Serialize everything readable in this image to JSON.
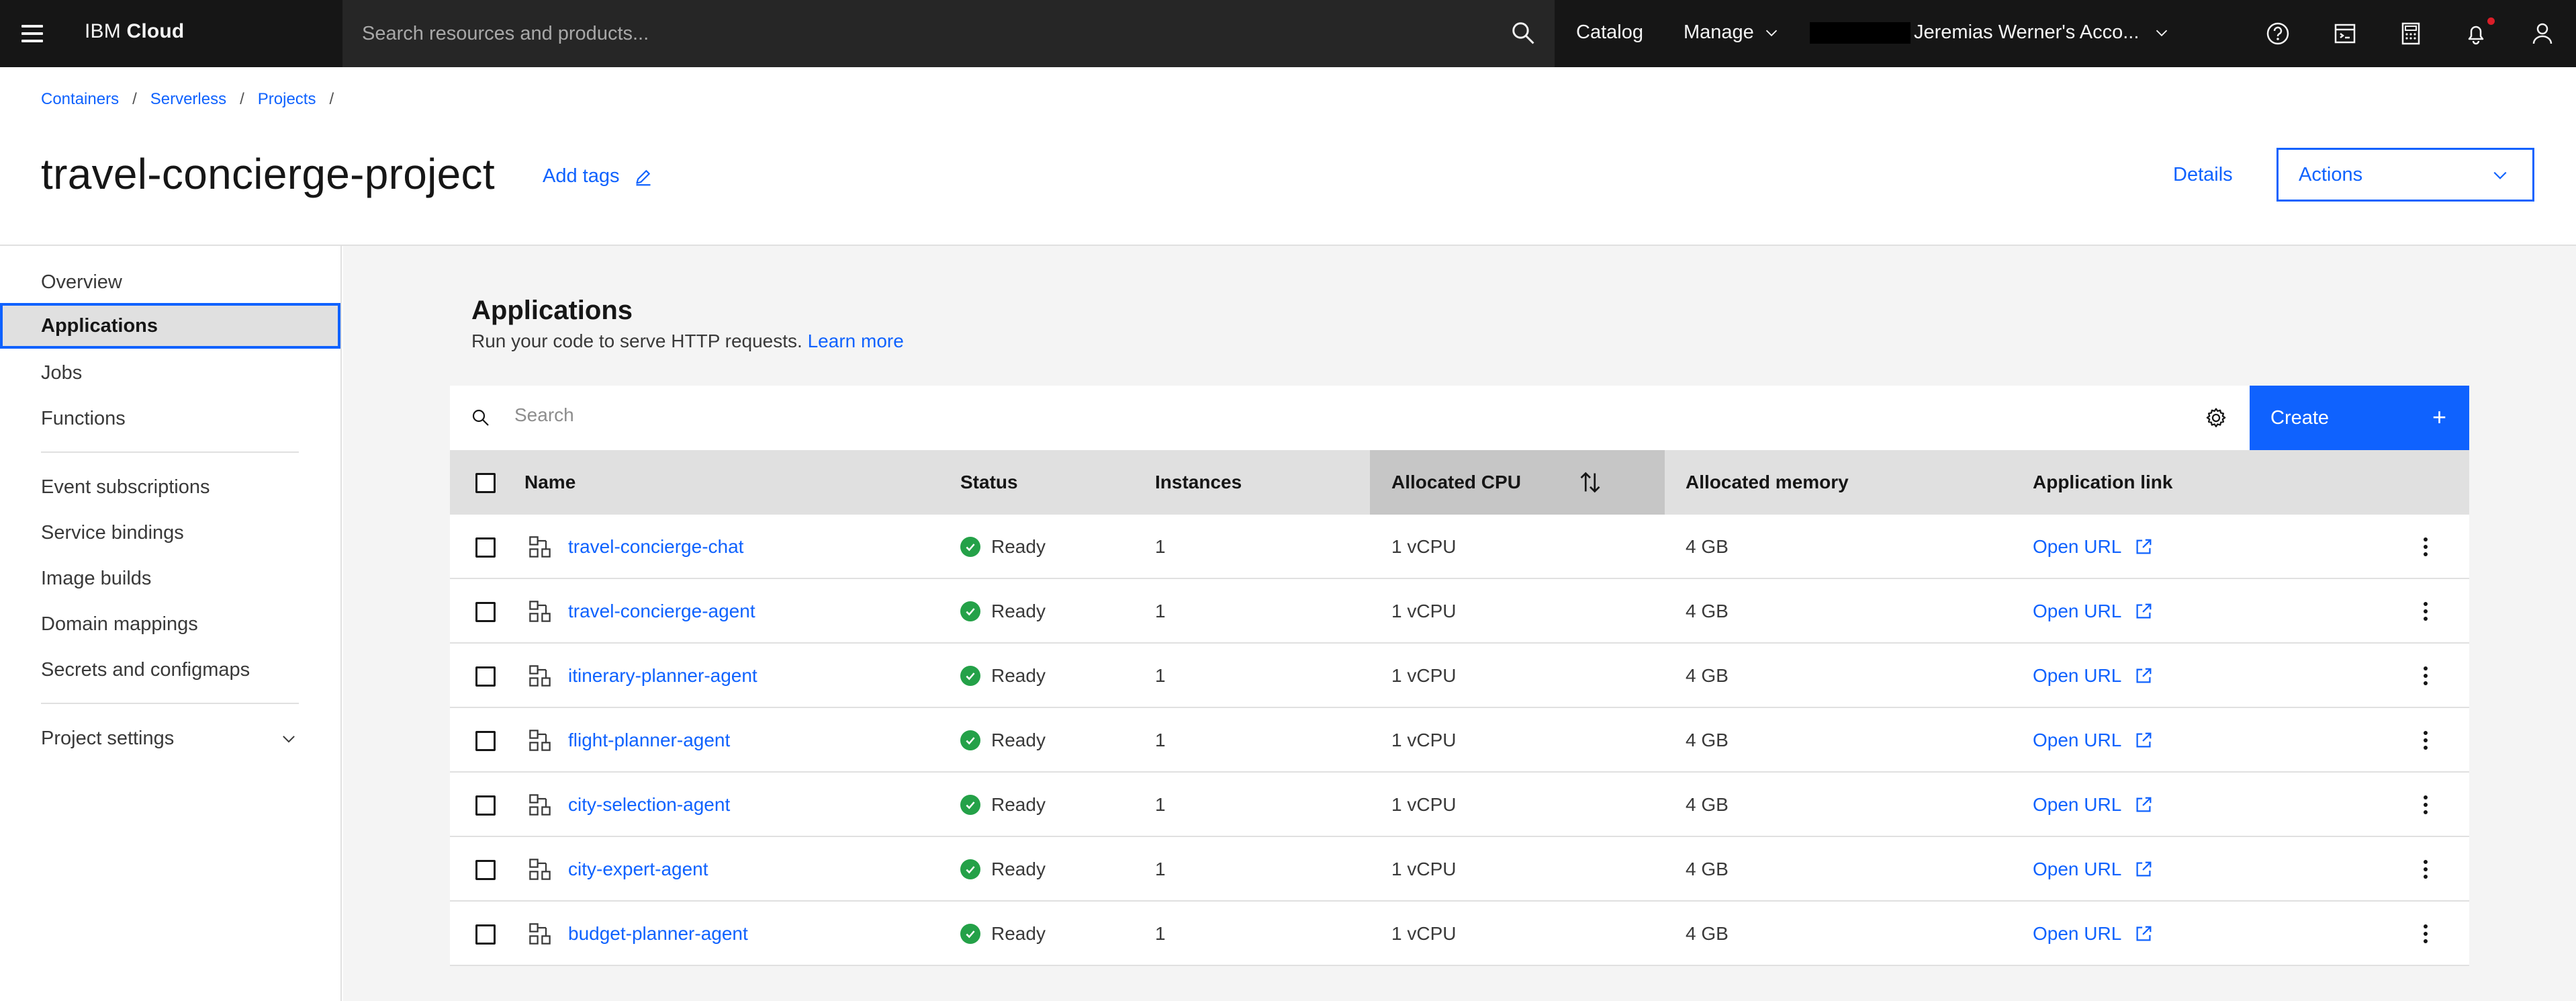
{
  "header": {
    "brand_light": "IBM",
    "brand_bold": "Cloud",
    "search_placeholder": "Search resources and products...",
    "catalog": "Catalog",
    "manage": "Manage",
    "account": "Jeremias Werner's Acco..."
  },
  "breadcrumb": [
    "Containers",
    "Serverless",
    "Projects"
  ],
  "page": {
    "title": "travel-concierge-project",
    "add_tags": "Add tags",
    "details": "Details",
    "actions": "Actions"
  },
  "sidenav": {
    "items": [
      "Overview",
      "Applications",
      "Jobs",
      "Functions"
    ],
    "items2": [
      "Event subscriptions",
      "Service bindings",
      "Image builds",
      "Domain mappings",
      "Secrets and configmaps"
    ],
    "settings": "Project settings",
    "active": "Applications"
  },
  "section": {
    "title": "Applications",
    "subtitle": "Run your code to serve HTTP requests.",
    "learn_more": "Learn more"
  },
  "toolbar": {
    "search_placeholder": "Search",
    "create": "Create"
  },
  "table": {
    "columns": [
      "Name",
      "Status",
      "Instances",
      "Allocated CPU",
      "Allocated memory",
      "Application link"
    ],
    "sorted_column": "Allocated CPU",
    "rows": [
      {
        "name": "travel-concierge-chat",
        "status": "Ready",
        "instances": "1",
        "cpu": "1 vCPU",
        "memory": "4 GB",
        "link": "Open URL"
      },
      {
        "name": "travel-concierge-agent",
        "status": "Ready",
        "instances": "1",
        "cpu": "1 vCPU",
        "memory": "4 GB",
        "link": "Open URL"
      },
      {
        "name": "itinerary-planner-agent",
        "status": "Ready",
        "instances": "1",
        "cpu": "1 vCPU",
        "memory": "4 GB",
        "link": "Open URL"
      },
      {
        "name": "flight-planner-agent",
        "status": "Ready",
        "instances": "1",
        "cpu": "1 vCPU",
        "memory": "4 GB",
        "link": "Open URL"
      },
      {
        "name": "city-selection-agent",
        "status": "Ready",
        "instances": "1",
        "cpu": "1 vCPU",
        "memory": "4 GB",
        "link": "Open URL"
      },
      {
        "name": "city-expert-agent",
        "status": "Ready",
        "instances": "1",
        "cpu": "1 vCPU",
        "memory": "4 GB",
        "link": "Open URL"
      },
      {
        "name": "budget-planner-agent",
        "status": "Ready",
        "instances": "1",
        "cpu": "1 vCPU",
        "memory": "4 GB",
        "link": "Open URL"
      }
    ]
  },
  "colors": {
    "accent": "#0f62fe",
    "header_bg": "#161616",
    "success": "#24a148",
    "notification": "#da1e28"
  }
}
